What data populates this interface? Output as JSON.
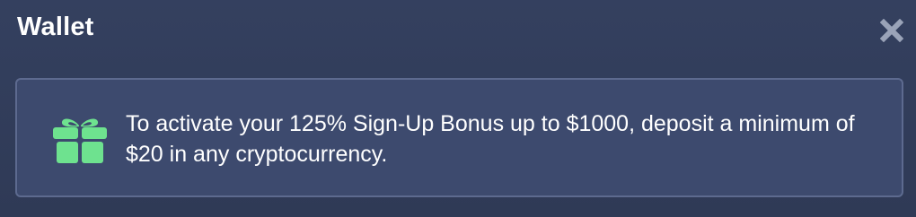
{
  "window": {
    "title": "Wallet"
  },
  "icons": {
    "close": "close-icon",
    "gift": "gift-icon"
  },
  "colors": {
    "background": "#2f3b58",
    "banner_bg": "#3d4a6e",
    "banner_border": "#5d6a8f",
    "gift_accent": "#6ee28f",
    "close_icon": "#9aa3b8"
  },
  "banner": {
    "message": "To activate your 125% Sign-Up Bonus up to $1000, deposit a minimum of $20 in any cryptocurrency."
  }
}
